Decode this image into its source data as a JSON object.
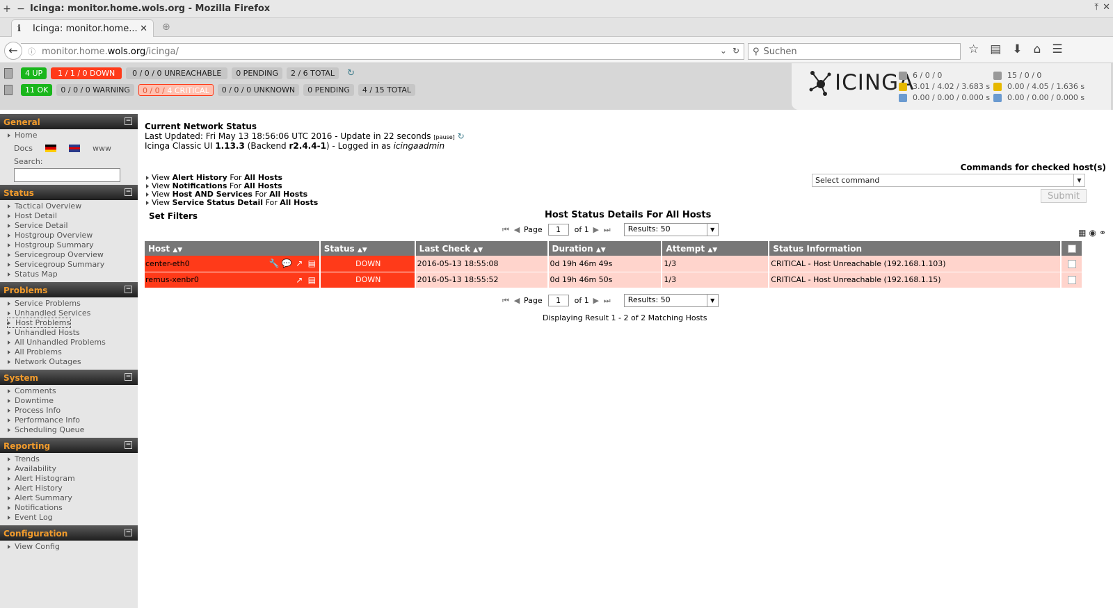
{
  "browser": {
    "window_title": "Icinga: monitor.home.wols.org - Mozilla Firefox",
    "tab_label": "Icinga: monitor.home...",
    "url_prefix": "monitor.home.",
    "url_domain": "wols.org",
    "url_path": "/icinga/",
    "search_placeholder": "Suchen"
  },
  "status_bar": {
    "hosts": {
      "up": "4 UP",
      "down": "1 / 1 / 0 DOWN",
      "unreachable": "0 / 0 / 0 UNREACHABLE",
      "pending": "0 PENDING",
      "total": "2 / 6 TOTAL"
    },
    "services": {
      "ok": "11 OK",
      "warning": "0 / 0 / 0 WARNING",
      "critical_a": "0 / 0 /",
      "critical_b": "4 CRITICAL",
      "unknown": "0 / 0 / 0 UNKNOWN",
      "pending": "0 PENDING",
      "total": "4 / 15 TOTAL"
    }
  },
  "brand": {
    "logo_text": "ICINGA",
    "perf_left": [
      "6 / 0 / 0",
      "3.01 / 4.02 / 3.683 s",
      "0.00 / 0.00 / 0.000 s"
    ],
    "perf_right": [
      "15 / 0 / 0",
      "0.00 / 4.05 / 1.636 s",
      "0.00 / 0.00 / 0.000 s"
    ]
  },
  "sidebar": {
    "general": {
      "title": "General",
      "home": "Home",
      "docs": "Docs",
      "www": "www",
      "search_label": "Search:"
    },
    "status": {
      "title": "Status",
      "items": [
        "Tactical Overview",
        "Host Detail",
        "Service Detail",
        "Hostgroup Overview",
        "Hostgroup Summary",
        "Servicegroup Overview",
        "Servicegroup Summary",
        "Status Map"
      ]
    },
    "problems": {
      "title": "Problems",
      "items": [
        "Service Problems",
        "Unhandled Services",
        "Host Problems",
        "Unhandled Hosts",
        "All Unhandled Problems",
        "All Problems",
        "Network Outages"
      ]
    },
    "system": {
      "title": "System",
      "items": [
        "Comments",
        "Downtime",
        "Process Info",
        "Performance Info",
        "Scheduling Queue"
      ]
    },
    "reporting": {
      "title": "Reporting",
      "items": [
        "Trends",
        "Availability",
        "Alert Histogram",
        "Alert History",
        "Alert Summary",
        "Notifications",
        "Event Log"
      ]
    },
    "configuration": {
      "title": "Configuration",
      "items": [
        "View Config"
      ]
    }
  },
  "main": {
    "title": "Current Network Status",
    "last_updated": "Last Updated: Fri May 13 18:56:06 UTC 2016 - Update in 22 seconds",
    "pause": "[pause]",
    "version_prefix": "Icinga Classic UI",
    "version": "1.13.3",
    "backend_prefix": "(Backend",
    "backend": "r2.4.4-1",
    "logged_in": ") - Logged in as",
    "user": "icingaadmin",
    "links": [
      {
        "pre": "View",
        "bold": "Alert History",
        "mid": "For",
        "bold2": "All Hosts"
      },
      {
        "pre": "View",
        "bold": "Notifications",
        "mid": "For",
        "bold2": "All Hosts"
      },
      {
        "pre": "View",
        "bold": "Host AND Services",
        "mid": "For",
        "bold2": "All Hosts"
      },
      {
        "pre": "View",
        "bold": "Service Status Detail",
        "mid": "For",
        "bold2": "All Hosts"
      }
    ],
    "set_filters": "Set Filters",
    "table_title": "Host Status Details For All Hosts",
    "commands_title": "Commands for checked host(s)",
    "command_select": "Select command",
    "submit": "Submit",
    "pager": {
      "page_label": "Page",
      "page": "1",
      "of": "of 1",
      "results": "Results: 50"
    },
    "columns": [
      "Host",
      "Status",
      "Last Check",
      "Duration",
      "Attempt",
      "Status Information"
    ],
    "rows": [
      {
        "host": "center-eth0",
        "status": "DOWN",
        "last_check": "2016-05-13 18:55:08",
        "duration": "0d 19h 46m 49s",
        "attempt": "1/3",
        "info": "CRITICAL - Host Unreachable (192.168.1.103)"
      },
      {
        "host": "remus-xenbr0",
        "status": "DOWN",
        "last_check": "2016-05-13 18:55:52",
        "duration": "0d 19h 46m 50s",
        "attempt": "1/3",
        "info": "CRITICAL - Host Unreachable (192.168.1.15)"
      }
    ],
    "displaying": "Displaying Result 1 - 2 of 2 Matching Hosts"
  }
}
